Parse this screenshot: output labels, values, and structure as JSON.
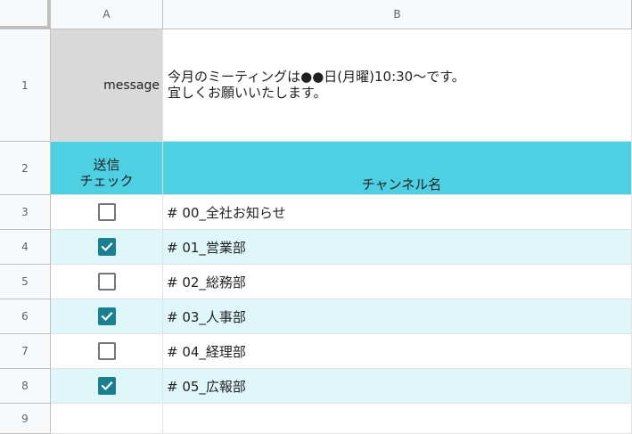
{
  "columns": [
    "A",
    "B"
  ],
  "row_numbers": [
    "1",
    "2",
    "3",
    "4",
    "5",
    "6",
    "7",
    "8",
    "9"
  ],
  "message": {
    "label": "message",
    "line1": "今月のミーティングは●●日(月曜)10:30～です。",
    "line2": "宜しくお願いいたします。"
  },
  "table_header": {
    "check_line1": "送信",
    "check_line2": "チェック",
    "channel": "チャンネル名"
  },
  "channels": [
    {
      "name": "# 00_全社お知らせ",
      "checked": false
    },
    {
      "name": "# 01_営業部",
      "checked": true
    },
    {
      "name": "# 02_総務部",
      "checked": false
    },
    {
      "name": "# 03_人事部",
      "checked": true
    },
    {
      "name": "# 04_経理部",
      "checked": false
    },
    {
      "name": "# 05_広報部",
      "checked": true
    }
  ],
  "colors": {
    "header_fill": "#4dd0e1",
    "band_fill": "#e0f7fa",
    "checkbox_checked": "#1a7f8e",
    "label_fill": "#d9d9d9"
  },
  "icons": {
    "checked": "checkbox-checked-icon",
    "unchecked": "checkbox-unchecked-icon"
  }
}
